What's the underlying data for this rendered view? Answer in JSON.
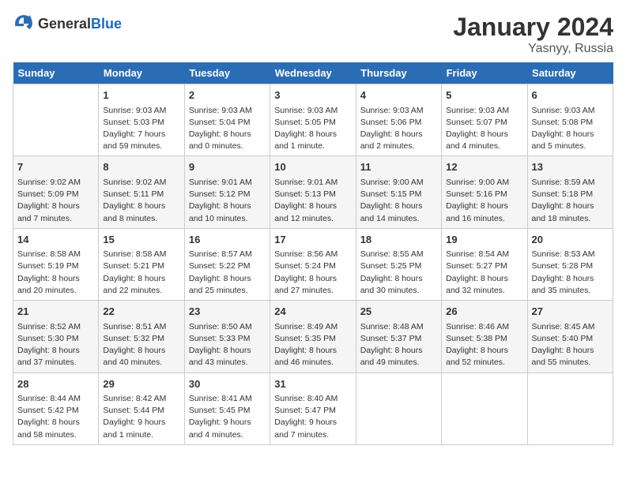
{
  "header": {
    "logo_general": "General",
    "logo_blue": "Blue",
    "month": "January 2024",
    "location": "Yasnyy, Russia"
  },
  "days": [
    "Sunday",
    "Monday",
    "Tuesday",
    "Wednesday",
    "Thursday",
    "Friday",
    "Saturday"
  ],
  "weeks": [
    [
      {
        "date": "",
        "sunrise": "",
        "sunset": "",
        "daylight": ""
      },
      {
        "date": "1",
        "sunrise": "Sunrise: 9:03 AM",
        "sunset": "Sunset: 5:03 PM",
        "daylight": "Daylight: 7 hours and 59 minutes."
      },
      {
        "date": "2",
        "sunrise": "Sunrise: 9:03 AM",
        "sunset": "Sunset: 5:04 PM",
        "daylight": "Daylight: 8 hours and 0 minutes."
      },
      {
        "date": "3",
        "sunrise": "Sunrise: 9:03 AM",
        "sunset": "Sunset: 5:05 PM",
        "daylight": "Daylight: 8 hours and 1 minute."
      },
      {
        "date": "4",
        "sunrise": "Sunrise: 9:03 AM",
        "sunset": "Sunset: 5:06 PM",
        "daylight": "Daylight: 8 hours and 2 minutes."
      },
      {
        "date": "5",
        "sunrise": "Sunrise: 9:03 AM",
        "sunset": "Sunset: 5:07 PM",
        "daylight": "Daylight: 8 hours and 4 minutes."
      },
      {
        "date": "6",
        "sunrise": "Sunrise: 9:03 AM",
        "sunset": "Sunset: 5:08 PM",
        "daylight": "Daylight: 8 hours and 5 minutes."
      }
    ],
    [
      {
        "date": "7",
        "sunrise": "Sunrise: 9:02 AM",
        "sunset": "Sunset: 5:09 PM",
        "daylight": "Daylight: 8 hours and 7 minutes."
      },
      {
        "date": "8",
        "sunrise": "Sunrise: 9:02 AM",
        "sunset": "Sunset: 5:11 PM",
        "daylight": "Daylight: 8 hours and 8 minutes."
      },
      {
        "date": "9",
        "sunrise": "Sunrise: 9:01 AM",
        "sunset": "Sunset: 5:12 PM",
        "daylight": "Daylight: 8 hours and 10 minutes."
      },
      {
        "date": "10",
        "sunrise": "Sunrise: 9:01 AM",
        "sunset": "Sunset: 5:13 PM",
        "daylight": "Daylight: 8 hours and 12 minutes."
      },
      {
        "date": "11",
        "sunrise": "Sunrise: 9:00 AM",
        "sunset": "Sunset: 5:15 PM",
        "daylight": "Daylight: 8 hours and 14 minutes."
      },
      {
        "date": "12",
        "sunrise": "Sunrise: 9:00 AM",
        "sunset": "Sunset: 5:16 PM",
        "daylight": "Daylight: 8 hours and 16 minutes."
      },
      {
        "date": "13",
        "sunrise": "Sunrise: 8:59 AM",
        "sunset": "Sunset: 5:18 PM",
        "daylight": "Daylight: 8 hours and 18 minutes."
      }
    ],
    [
      {
        "date": "14",
        "sunrise": "Sunrise: 8:58 AM",
        "sunset": "Sunset: 5:19 PM",
        "daylight": "Daylight: 8 hours and 20 minutes."
      },
      {
        "date": "15",
        "sunrise": "Sunrise: 8:58 AM",
        "sunset": "Sunset: 5:21 PM",
        "daylight": "Daylight: 8 hours and 22 minutes."
      },
      {
        "date": "16",
        "sunrise": "Sunrise: 8:57 AM",
        "sunset": "Sunset: 5:22 PM",
        "daylight": "Daylight: 8 hours and 25 minutes."
      },
      {
        "date": "17",
        "sunrise": "Sunrise: 8:56 AM",
        "sunset": "Sunset: 5:24 PM",
        "daylight": "Daylight: 8 hours and 27 minutes."
      },
      {
        "date": "18",
        "sunrise": "Sunrise: 8:55 AM",
        "sunset": "Sunset: 5:25 PM",
        "daylight": "Daylight: 8 hours and 30 minutes."
      },
      {
        "date": "19",
        "sunrise": "Sunrise: 8:54 AM",
        "sunset": "Sunset: 5:27 PM",
        "daylight": "Daylight: 8 hours and 32 minutes."
      },
      {
        "date": "20",
        "sunrise": "Sunrise: 8:53 AM",
        "sunset": "Sunset: 5:28 PM",
        "daylight": "Daylight: 8 hours and 35 minutes."
      }
    ],
    [
      {
        "date": "21",
        "sunrise": "Sunrise: 8:52 AM",
        "sunset": "Sunset: 5:30 PM",
        "daylight": "Daylight: 8 hours and 37 minutes."
      },
      {
        "date": "22",
        "sunrise": "Sunrise: 8:51 AM",
        "sunset": "Sunset: 5:32 PM",
        "daylight": "Daylight: 8 hours and 40 minutes."
      },
      {
        "date": "23",
        "sunrise": "Sunrise: 8:50 AM",
        "sunset": "Sunset: 5:33 PM",
        "daylight": "Daylight: 8 hours and 43 minutes."
      },
      {
        "date": "24",
        "sunrise": "Sunrise: 8:49 AM",
        "sunset": "Sunset: 5:35 PM",
        "daylight": "Daylight: 8 hours and 46 minutes."
      },
      {
        "date": "25",
        "sunrise": "Sunrise: 8:48 AM",
        "sunset": "Sunset: 5:37 PM",
        "daylight": "Daylight: 8 hours and 49 minutes."
      },
      {
        "date": "26",
        "sunrise": "Sunrise: 8:46 AM",
        "sunset": "Sunset: 5:38 PM",
        "daylight": "Daylight: 8 hours and 52 minutes."
      },
      {
        "date": "27",
        "sunrise": "Sunrise: 8:45 AM",
        "sunset": "Sunset: 5:40 PM",
        "daylight": "Daylight: 8 hours and 55 minutes."
      }
    ],
    [
      {
        "date": "28",
        "sunrise": "Sunrise: 8:44 AM",
        "sunset": "Sunset: 5:42 PM",
        "daylight": "Daylight: 8 hours and 58 minutes."
      },
      {
        "date": "29",
        "sunrise": "Sunrise: 8:42 AM",
        "sunset": "Sunset: 5:44 PM",
        "daylight": "Daylight: 9 hours and 1 minute."
      },
      {
        "date": "30",
        "sunrise": "Sunrise: 8:41 AM",
        "sunset": "Sunset: 5:45 PM",
        "daylight": "Daylight: 9 hours and 4 minutes."
      },
      {
        "date": "31",
        "sunrise": "Sunrise: 8:40 AM",
        "sunset": "Sunset: 5:47 PM",
        "daylight": "Daylight: 9 hours and 7 minutes."
      },
      {
        "date": "",
        "sunrise": "",
        "sunset": "",
        "daylight": ""
      },
      {
        "date": "",
        "sunrise": "",
        "sunset": "",
        "daylight": ""
      },
      {
        "date": "",
        "sunrise": "",
        "sunset": "",
        "daylight": ""
      }
    ]
  ]
}
